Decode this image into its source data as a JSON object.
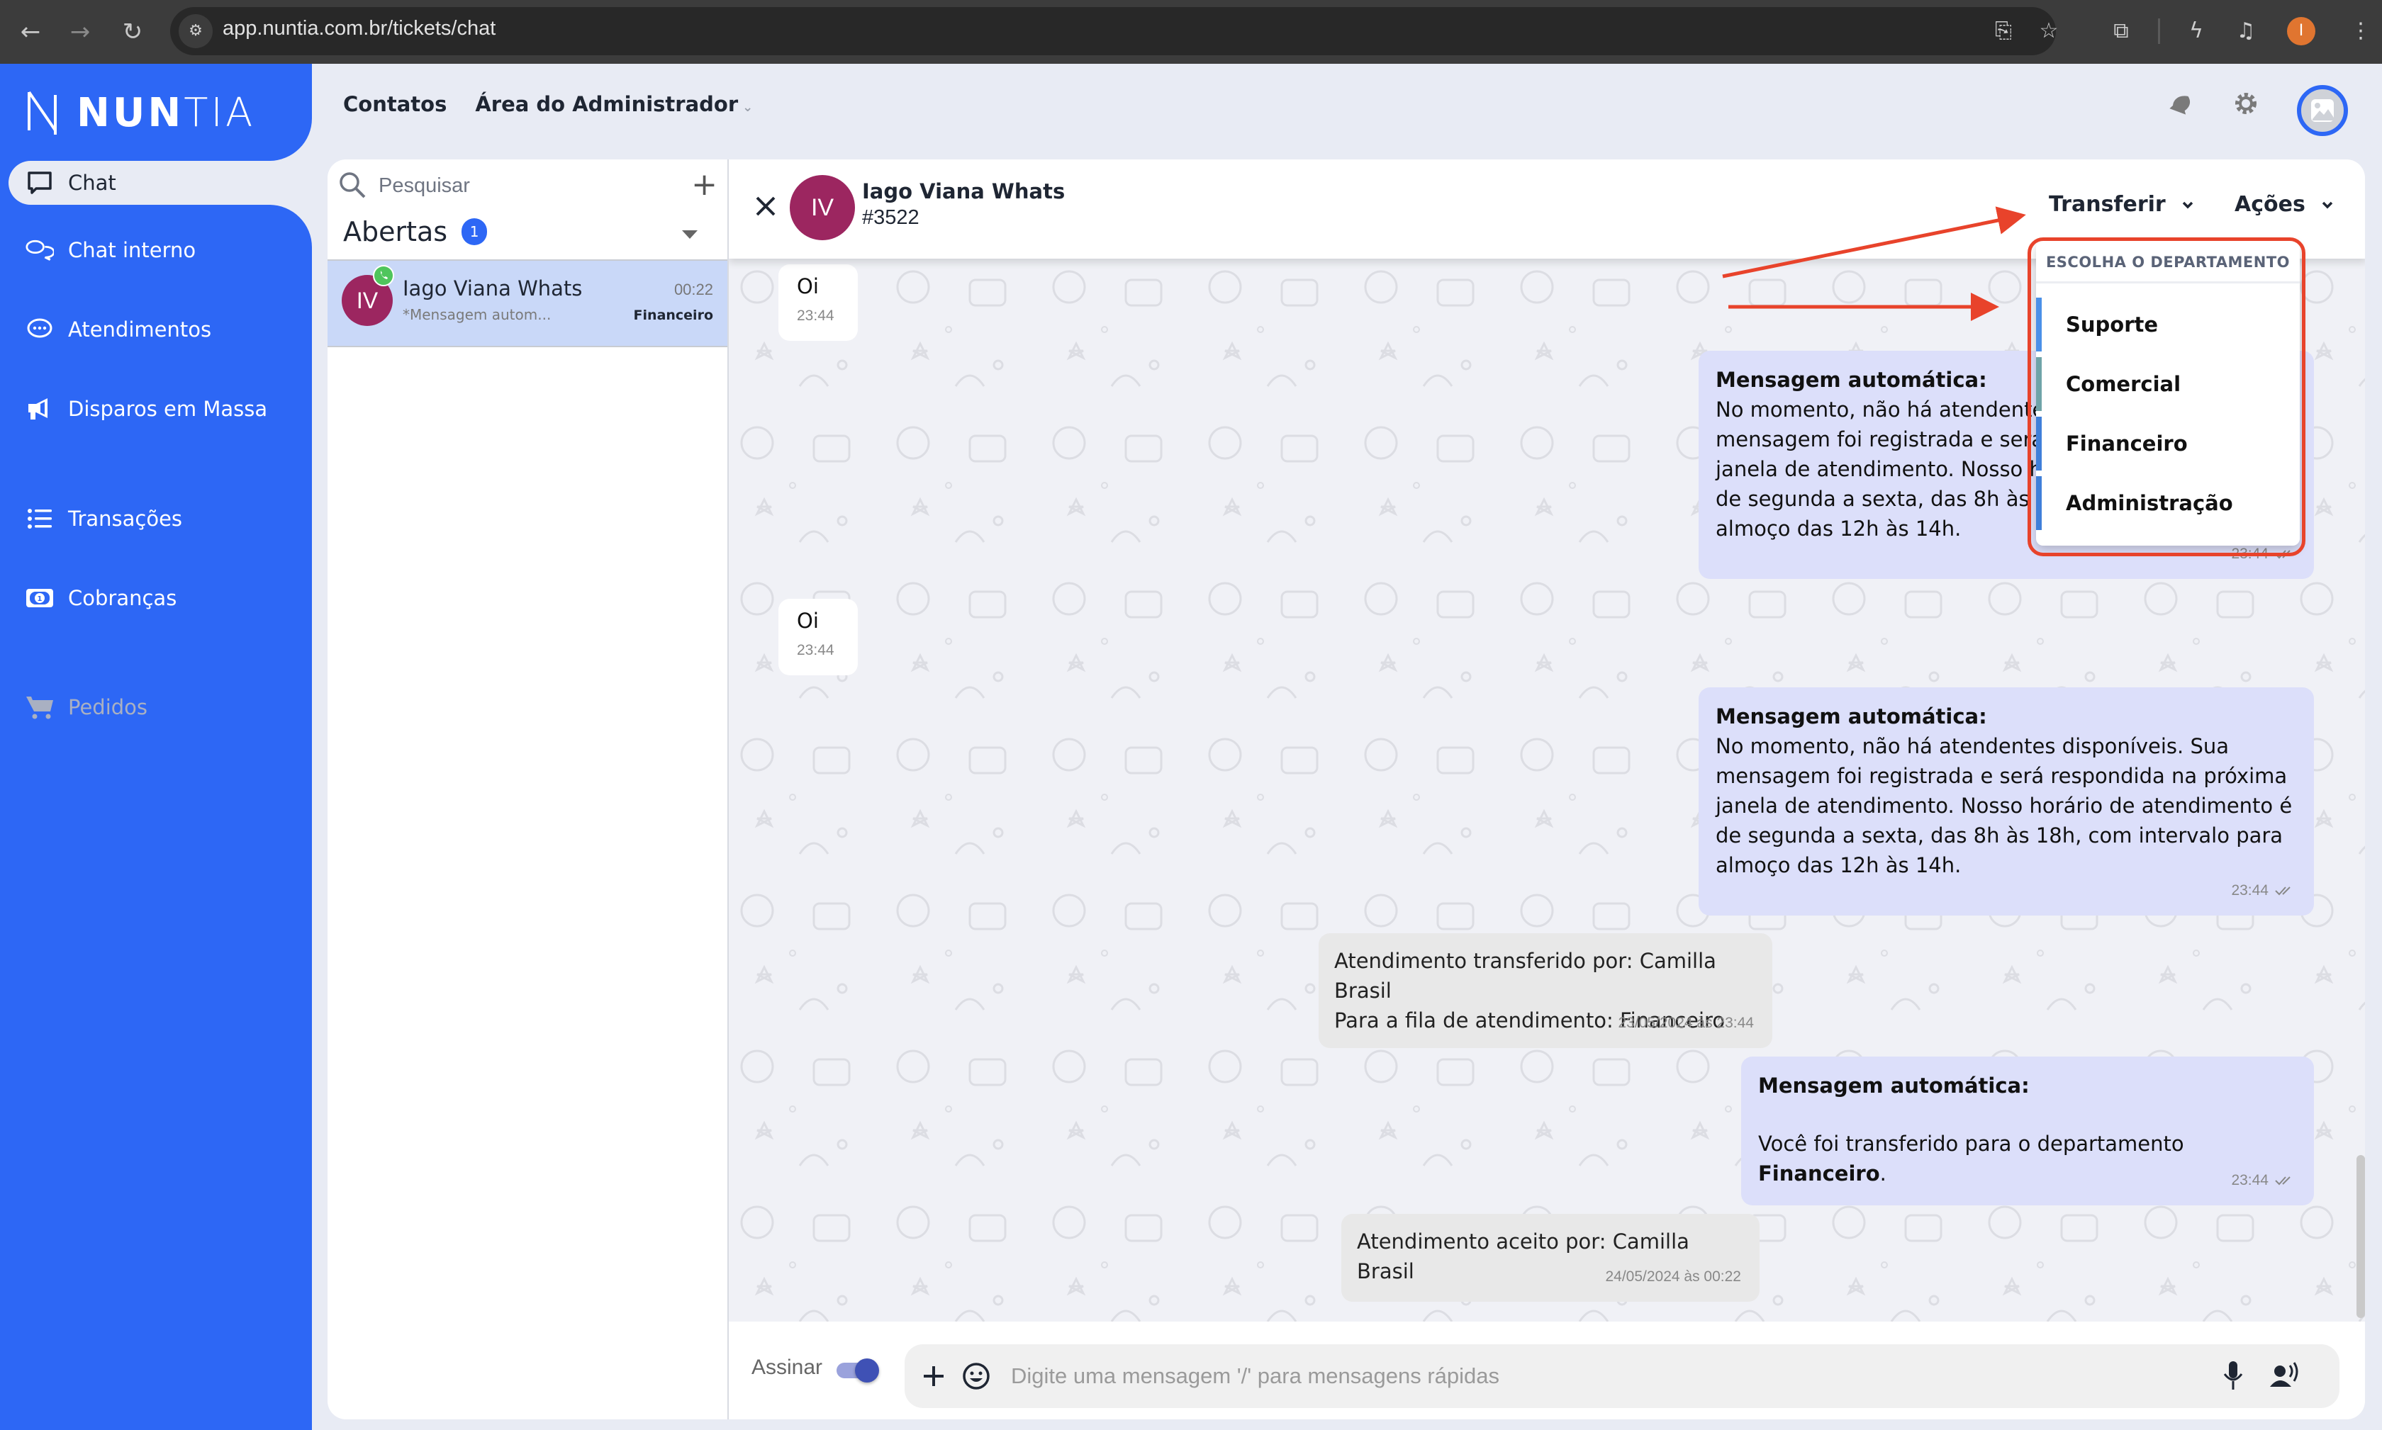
{
  "browser": {
    "url": "app.nuntia.com.br/tickets/chat",
    "profile_initial": "I",
    "icons": [
      "back-icon",
      "forward-icon",
      "reload-icon",
      "site-info-icon",
      "install-app-icon",
      "bookmark-star-icon",
      "extensions-icon",
      "energy-saver-icon",
      "media-control-icon",
      "more-menu-icon"
    ]
  },
  "brand": {
    "name_bold": "NUN",
    "name_light": "TIA",
    "color": "#2d67f5"
  },
  "sidebar": {
    "items": [
      {
        "label": "Chat",
        "icon": "chat-bubble-icon",
        "active": true
      },
      {
        "label": "Chat interno",
        "icon": "chat-bubbles-icon"
      },
      {
        "label": "Atendimentos",
        "icon": "chat-dots-icon"
      },
      {
        "label": "Disparos em Massa",
        "icon": "megaphone-icon"
      },
      {
        "label": "Transações",
        "icon": "list-icon"
      },
      {
        "label": "Cobranças",
        "icon": "money-bill-icon"
      },
      {
        "label": "Pedidos",
        "icon": "cart-icon",
        "disabled": true
      }
    ]
  },
  "topnav": {
    "contacts": "Contatos",
    "admin": "Área do Administrador",
    "icons": [
      "notification-bell-icon",
      "settings-gear-icon",
      "user-avatar-icon"
    ]
  },
  "ticket_list": {
    "search_placeholder": "Pesquisar",
    "section_label": "Abertas",
    "section_count": "1",
    "tickets": [
      {
        "initials": "IV",
        "name": "Iago Viana Whats",
        "preview": "*Mensagem autom...",
        "time": "00:22",
        "department": "Financeiro",
        "channel": "whatsapp"
      }
    ]
  },
  "chat": {
    "contact_initials": "IV",
    "contact_name": "Iago Viana Whats",
    "ticket_id": "#3522",
    "transfer_label": "Transferir",
    "actions_label": "Ações",
    "messages": [
      {
        "type": "in",
        "text": "Oi",
        "time": "23:44"
      },
      {
        "type": "out",
        "title": "Mensagem automática:",
        "text": "No momento, não há atendentes disponíveis. Sua mensagem foi registrada e será respondida na próxima janela de atendimento. Nosso horário de atendimento é de segunda a sexta, das 8h às 18h, com intervalo para almoço das 12h às 14h.",
        "time": "23:44"
      },
      {
        "type": "in",
        "text": "Oi",
        "time": "23:44"
      },
      {
        "type": "out",
        "title": "Mensagem automática:",
        "text": "No momento, não há atendentes disponíveis. Sua mensagem foi registrada e será respondida na próxima janela de atendimento. Nosso horário de atendimento é de segunda a sexta, das 8h às 18h, com intervalo para almoço das 12h às 14h.",
        "time": "23:44"
      },
      {
        "type": "sys",
        "line1": "Atendimento transferido por: Camilla Brasil",
        "line2": "Para a fila de atendimento: Financeiro",
        "time": "23/05/2024 às 23:44"
      },
      {
        "type": "out",
        "title": "Mensagem automática:",
        "text_prefix": "Você foi transferido para o departamento ",
        "text_bold": "Financeiro",
        "text_suffix": ".",
        "time": "23:44"
      },
      {
        "type": "sys",
        "line1": "Atendimento aceito por: Camilla Brasil",
        "time": "24/05/2024 às 00:22"
      }
    ],
    "composer": {
      "sign_label": "Assinar",
      "sign_enabled": true,
      "placeholder": "Digite uma mensagem '/' para mensagens rápidas"
    }
  },
  "transfer_dropdown": {
    "header": "ESCOLHA O DEPARTAMENTO",
    "options": [
      {
        "label": "Suporte",
        "color": "#4a90e8"
      },
      {
        "label": "Comercial",
        "color": "#6fa3a8"
      },
      {
        "label": "Financeiro",
        "color": "#3f7fd9"
      },
      {
        "label": "Administração",
        "color": "#3f7fd9"
      }
    ]
  },
  "annotation": {
    "color": "#e8432b"
  }
}
